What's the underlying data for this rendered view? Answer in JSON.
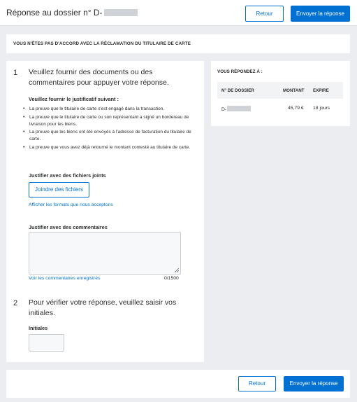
{
  "header": {
    "title": "Réponse au dossier n° D-",
    "back_label": "Retour",
    "submit_label": "Envoyer la réponse"
  },
  "banner": {
    "text": "VOUS N'ÊTES PAS D'ACCORD AVEC LA RÉCLAMATION DU TITULAIRE DE CARTE"
  },
  "step1": {
    "number": "1",
    "text": "Veuillez fournir des documents ou des commentaires pour appuyer votre réponse.",
    "evidence_heading": "Veuillez fournir le justificatif suivant :",
    "requirements": [
      "La preuve que le titulaire de carte s'est engagé dans la transaction.",
      "La preuve que le titulaire de carte ou son représentant a signé un bordereau de livraison pour les biens.",
      "La preuve que les biens ont été envoyés à l'adresse de facturation du titulaire de carte.",
      "La preuve que vous avez déjà retourné le montant contesté au titulaire de carte."
    ],
    "files_heading": "Justifier avec des fichiers joints",
    "attach_label": "Joindre des fichiers",
    "formats_link": "Afficher les formats que nous acceptons",
    "comments_heading": "Justifier avec des commentaires",
    "comment_value": "",
    "saved_comments_link": "Voir les commentaires enregistrés",
    "char_counter": "0/1500"
  },
  "step2": {
    "number": "2",
    "text": "Pour vérifier votre réponse, veuillez saisir vos initiales.",
    "initials_label": "Initiales",
    "initials_value": ""
  },
  "summary": {
    "title": "VOUS RÉPONDEZ À :",
    "columns": [
      "N° DE DOSSIER",
      "MONTANT",
      "EXPIRE"
    ],
    "row": {
      "case_prefix": "D-",
      "amount": "45,79 €",
      "expires": "18 jours"
    }
  },
  "footer": {
    "back_label": "Retour",
    "submit_label": "Envoyer la réponse"
  },
  "colors": {
    "accent": "#0070d2",
    "background": "#ebedf0",
    "redaction": "#cfd2d6"
  }
}
